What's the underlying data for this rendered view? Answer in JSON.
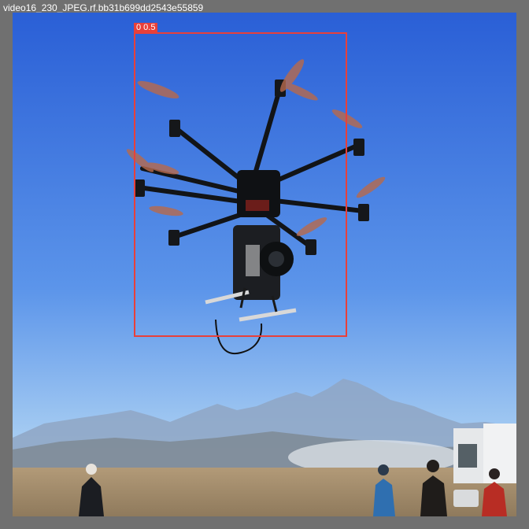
{
  "window": {
    "title": "video16_230_JPEG.rf.bb31b699dd2543e55859"
  },
  "detection": {
    "label": "0 0.5",
    "color": "#e8403a"
  },
  "colors": {
    "frame": "#707070",
    "sky_top": "#2d63d8",
    "sky_bottom": "#9cc6f0",
    "ground": "#a08a68"
  }
}
